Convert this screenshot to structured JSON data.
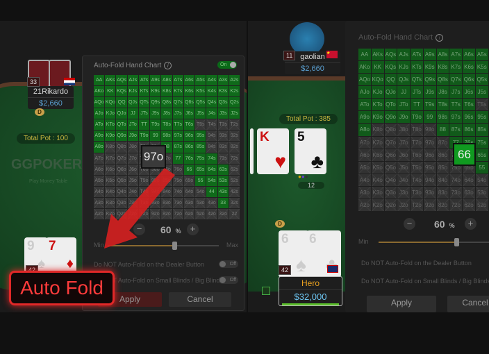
{
  "chart_title": "Auto-Fold Hand Chart",
  "info_icon": "i",
  "toggle_on": "On",
  "toggle_off": "Off",
  "hands": [
    [
      "AA",
      "AKs",
      "AQs",
      "AJs",
      "ATs",
      "A9s",
      "A8s",
      "A7s",
      "A6s",
      "A5s",
      "A4s",
      "A3s",
      "A2s"
    ],
    [
      "AKo",
      "KK",
      "KQs",
      "KJs",
      "KTs",
      "K9s",
      "K8s",
      "K7s",
      "K6s",
      "K5s",
      "K4s",
      "K3s",
      "K2s"
    ],
    [
      "AQo",
      "KQo",
      "QQ",
      "QJs",
      "QTs",
      "Q9s",
      "Q8s",
      "Q7s",
      "Q6s",
      "Q5s",
      "Q4s",
      "Q3s",
      "Q2s"
    ],
    [
      "AJo",
      "KJo",
      "QJo",
      "JJ",
      "JTs",
      "J9s",
      "J8s",
      "J7s",
      "J6s",
      "J5s",
      "J4s",
      "J3s",
      "J2s"
    ],
    [
      "ATo",
      "KTo",
      "QTo",
      "JTo",
      "TT",
      "T9s",
      "T8s",
      "T7s",
      "T6s",
      "T5s",
      "T4s",
      "T3s",
      "T2s"
    ],
    [
      "A9o",
      "K9o",
      "Q9o",
      "J9o",
      "T9o",
      "99",
      "98s",
      "97s",
      "96s",
      "95s",
      "94s",
      "93s",
      "92s"
    ],
    [
      "A8o",
      "K8o",
      "Q8o",
      "J8o",
      "T8o",
      "98o",
      "88",
      "87s",
      "86s",
      "85s",
      "84s",
      "83s",
      "82s"
    ],
    [
      "A7o",
      "K7o",
      "Q7o",
      "J7o",
      "T7o",
      "97o",
      "87o",
      "77",
      "76s",
      "75s",
      "74s",
      "73s",
      "72s"
    ],
    [
      "A6o",
      "K6o",
      "Q6o",
      "J6o",
      "T6o",
      "96o",
      "86o",
      "76o",
      "66",
      "65s",
      "64s",
      "63s",
      "62s"
    ],
    [
      "A5o",
      "K5o",
      "Q5o",
      "J5o",
      "T5o",
      "95o",
      "85o",
      "75o",
      "65o",
      "55",
      "54s",
      "53s",
      "52s"
    ],
    [
      "A4o",
      "K4o",
      "Q4o",
      "J4o",
      "T4o",
      "94o",
      "84o",
      "74o",
      "64o",
      "54o",
      "44",
      "43s",
      "42s"
    ],
    [
      "A3o",
      "K3o",
      "Q3o",
      "J3o",
      "T3o",
      "93o",
      "83o",
      "73o",
      "63o",
      "53o",
      "43o",
      "33",
      "32s"
    ],
    [
      "A2o",
      "K2o",
      "Q2o",
      "J2o",
      "T2o",
      "92o",
      "82o",
      "72o",
      "62o",
      "52o",
      "42o",
      "32o",
      "22"
    ]
  ],
  "playable_hands": [
    "ATo",
    "KTo",
    "QTo",
    "JTo",
    "TT",
    "T9s",
    "T8s",
    "T7s",
    "T6s",
    "A9o",
    "K9o",
    "Q9o",
    "J9o",
    "T9o",
    "99",
    "98s",
    "97s",
    "96s",
    "95s",
    "A8o",
    "88",
    "87s",
    "86s",
    "85s",
    "77",
    "76s",
    "75s",
    "74s",
    "66",
    "65s",
    "64s",
    "63s",
    "55",
    "54s",
    "53s",
    "44",
    "43s",
    "33"
  ],
  "colors": {
    "playable": "#0f6a1a",
    "folded": "#383838",
    "accent": "#e02828"
  },
  "percent": "60",
  "percent_unit": "%",
  "range_level": 0.6,
  "min_label": "Min",
  "max_label": "Max",
  "option_dealer": "Do NOT Auto-Fold on the Dealer Button",
  "option_blinds": "Do NOT Auto-Fold on Small Blinds / Big Blinds",
  "apply": "Apply",
  "cancel": "Cancel",
  "minus": "−",
  "plus": "+",
  "left": {
    "opponent": {
      "name": "21Rikardo",
      "stack": "$2,660",
      "level": "33"
    },
    "pot": "Total Pot : 100",
    "brand": "GGPOKER",
    "table_type": "Play Money Table",
    "dealer": "D",
    "hero_cards": [
      {
        "rank": "9",
        "suit": "♠"
      },
      {
        "rank": "7",
        "suit": "♦"
      }
    ],
    "hero_level": "42",
    "hovered_hand": "97o",
    "badge": "Auto Fold"
  },
  "right": {
    "opponent": {
      "name": "gaolian",
      "stack": "$2,660",
      "level": "11"
    },
    "pot": "Total Pot : 385",
    "board": [
      {
        "rank": "K",
        "suit": "♥"
      },
      {
        "rank": "5",
        "suit": "♣"
      }
    ],
    "bet": "12",
    "dealer": "D",
    "hero": {
      "name": "Hero",
      "stack": "$32,000",
      "level": "42"
    },
    "hero_cards": [
      {
        "rank": "6",
        "suit": "♠"
      },
      {
        "rank": "6",
        "suit": "♣"
      }
    ],
    "hovered_hand": "66"
  }
}
